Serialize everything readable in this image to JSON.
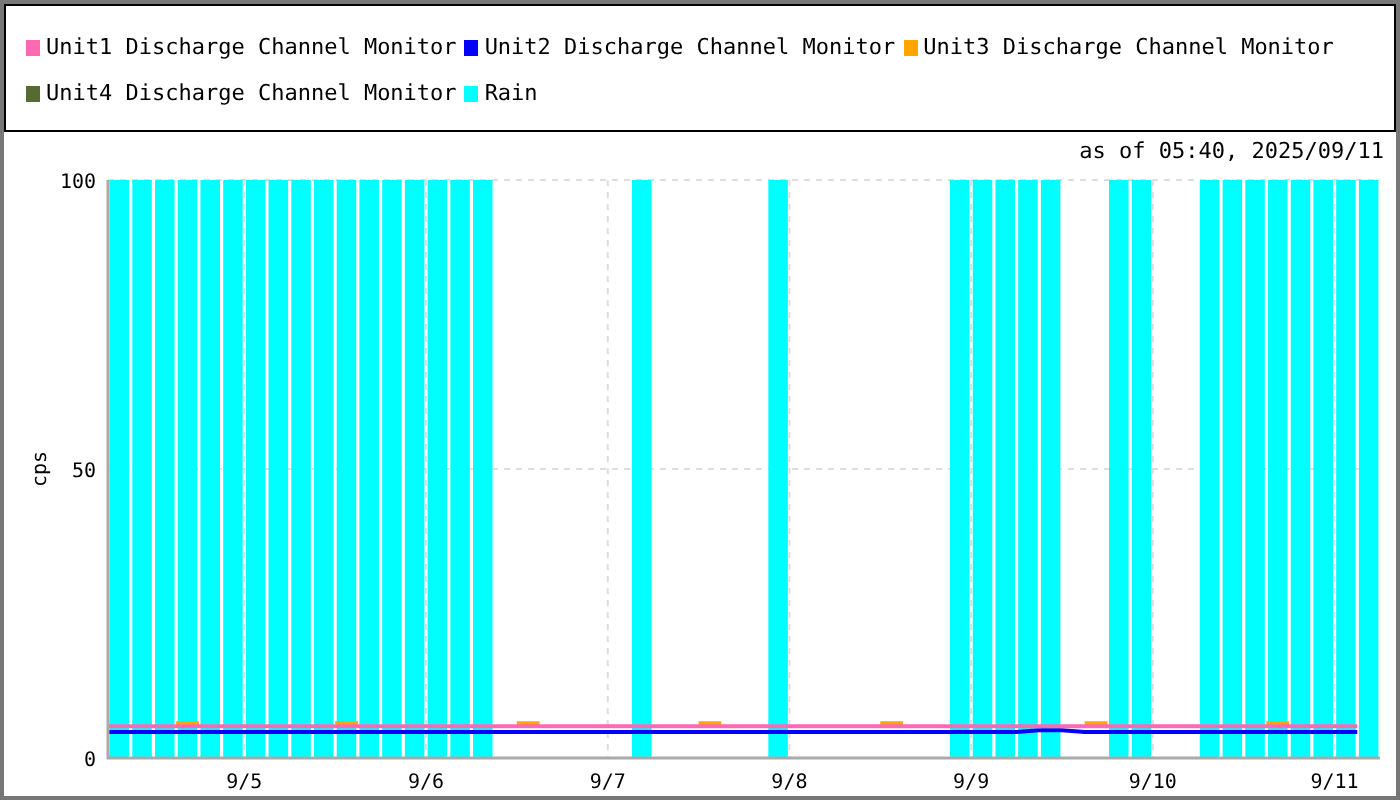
{
  "as_of": "as of 05:40, 2025/09/11",
  "chart_data": {
    "type": "line",
    "ylabel": "cps",
    "ylim": [
      0,
      100
    ],
    "grid": true,
    "yticks": [
      0,
      50,
      100
    ],
    "categories": [
      null,
      null,
      null,
      null,
      null,
      null,
      "9/5",
      null,
      null,
      null,
      null,
      null,
      null,
      null,
      "9/6",
      null,
      null,
      null,
      null,
      null,
      null,
      null,
      "9/7",
      null,
      null,
      null,
      null,
      null,
      null,
      null,
      "9/8",
      null,
      null,
      null,
      null,
      null,
      null,
      null,
      "9/9",
      null,
      null,
      null,
      null,
      null,
      null,
      null,
      "9/10",
      null,
      null,
      null,
      null,
      null,
      null,
      null,
      "9/11",
      null
    ],
    "series": [
      {
        "name": "Unit1 Discharge Channel Monitor",
        "color": "#ff69b4",
        "values": [
          5.5,
          5.5,
          5.5,
          5.5,
          5.5,
          5.5,
          5.5,
          5.5,
          5.5,
          5.5,
          5.5,
          5.5,
          5.5,
          5.5,
          5.5,
          5.5,
          5.5,
          5.5,
          5.5,
          5.5,
          5.5,
          5.5,
          5.5,
          5.5,
          5.5,
          5.5,
          5.5,
          5.5,
          5.5,
          5.5,
          5.5,
          5.5,
          5.5,
          5.5,
          5.5,
          5.5,
          5.5,
          5.5,
          5.5,
          5.5,
          5.5,
          5.5,
          5.5,
          5.5,
          5.5,
          5.5,
          5.5,
          5.5,
          5.5,
          5.5,
          5.5,
          5.5,
          5.5,
          5.5,
          5.5,
          5.5
        ]
      },
      {
        "name": "Unit2 Discharge Channel Monitor",
        "color": "#0000ff",
        "values": [
          4.5,
          4.5,
          4.5,
          4.5,
          4.5,
          4.5,
          4.5,
          4.5,
          4.5,
          4.5,
          4.5,
          4.5,
          4.5,
          4.5,
          4.5,
          4.5,
          4.5,
          4.5,
          4.5,
          4.5,
          4.5,
          4.5,
          4.5,
          4.5,
          4.5,
          4.5,
          4.5,
          4.5,
          4.5,
          4.5,
          4.5,
          4.5,
          4.5,
          4.5,
          4.5,
          4.5,
          4.5,
          4.5,
          4.5,
          4.5,
          4.5,
          4.8,
          4.8,
          4.5,
          4.5,
          4.5,
          4.5,
          4.5,
          4.5,
          4.5,
          4.5,
          4.5,
          4.5,
          4.5,
          4.5,
          4.5
        ]
      },
      {
        "name": "Unit3 Discharge Channel Monitor",
        "color": "#ffa500",
        "values": [
          null,
          null,
          null,
          6.0,
          6.0,
          null,
          null,
          null,
          null,
          null,
          6.0,
          6.0,
          null,
          null,
          null,
          null,
          null,
          null,
          6.0,
          6.0,
          null,
          null,
          null,
          null,
          null,
          null,
          6.0,
          6.0,
          null,
          null,
          null,
          null,
          null,
          null,
          6.0,
          6.0,
          null,
          null,
          null,
          null,
          null,
          null,
          null,
          6.0,
          6.0,
          null,
          null,
          null,
          null,
          null,
          null,
          6.0,
          6.0,
          null,
          null,
          null
        ]
      },
      {
        "name": "Unit4 Discharge Channel Monitor",
        "color": "#556b2f",
        "values": [
          null,
          null,
          null,
          null,
          null,
          null,
          null,
          null,
          null,
          null,
          null,
          null,
          null,
          null,
          null,
          null,
          null,
          null,
          null,
          null,
          null,
          null,
          null,
          null,
          null,
          null,
          null,
          null,
          null,
          null,
          null,
          null,
          null,
          null,
          null,
          null,
          null,
          null,
          null,
          null,
          null,
          null,
          null,
          null,
          null,
          null,
          null,
          null,
          null,
          null,
          null,
          null,
          null,
          null,
          null,
          null
        ]
      },
      {
        "name": "Rain",
        "color": "#00ffff",
        "type": "bar",
        "values": [
          100,
          100,
          100,
          100,
          100,
          100,
          100,
          100,
          100,
          100,
          100,
          100,
          100,
          100,
          100,
          100,
          100,
          null,
          null,
          null,
          null,
          null,
          null,
          100,
          null,
          null,
          null,
          null,
          null,
          100,
          null,
          null,
          null,
          null,
          null,
          null,
          null,
          100,
          100,
          100,
          100,
          100,
          null,
          null,
          100,
          100,
          null,
          null,
          100,
          100,
          100,
          100,
          100,
          100,
          100,
          100
        ]
      }
    ]
  }
}
